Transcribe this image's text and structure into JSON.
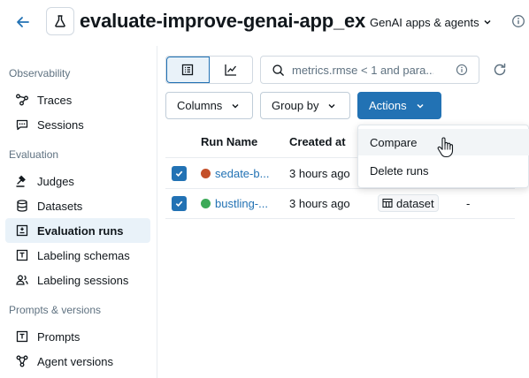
{
  "header": {
    "title": "evaluate-improve-genai-app_ex",
    "type_select": "GenAI apps & agents",
    "icons": [
      "arrow-left-icon",
      "beaker-icon",
      "chevron-down-icon",
      "info-icon"
    ]
  },
  "sidebar": {
    "sections": [
      {
        "label": "Observability",
        "items": [
          {
            "label": "Traces",
            "icon": "traces-icon"
          },
          {
            "label": "Sessions",
            "icon": "chat-bubble-icon"
          }
        ]
      },
      {
        "label": "Evaluation",
        "items": [
          {
            "label": "Judges",
            "icon": "gavel-icon"
          },
          {
            "label": "Datasets",
            "icon": "database-icon"
          },
          {
            "label": "Evaluation runs",
            "icon": "list-check-icon",
            "active": true
          },
          {
            "label": "Labeling schemas",
            "icon": "text-box-icon"
          },
          {
            "label": "Labeling sessions",
            "icon": "users-icon"
          }
        ]
      },
      {
        "label": "Prompts & versions",
        "items": [
          {
            "label": "Prompts",
            "icon": "text-box-icon"
          },
          {
            "label": "Agent versions",
            "icon": "nodes-icon"
          }
        ]
      }
    ]
  },
  "toolbar": {
    "search_placeholder": "metrics.rmse < 1 and para...",
    "columns_label": "Columns",
    "group_by_label": "Group by",
    "actions_label": "Actions"
  },
  "table": {
    "headers": {
      "run_name": "Run Name",
      "created_at": "Created at"
    },
    "rows": [
      {
        "name": "sedate-b...",
        "created": "3 hours ago",
        "dot_color": "#c4502a",
        "checked": true,
        "dataset": "",
        "extra": ""
      },
      {
        "name": "bustling-...",
        "created": "3 hours ago",
        "dot_color": "#3caa58",
        "checked": true,
        "dataset": "dataset",
        "extra": "-"
      }
    ]
  },
  "actions_menu": {
    "items": [
      "Compare",
      "Delete runs"
    ],
    "hovered": "Compare"
  },
  "colors": {
    "accent": "#2272b4",
    "active_nav_bg": "#e9f2f9"
  }
}
